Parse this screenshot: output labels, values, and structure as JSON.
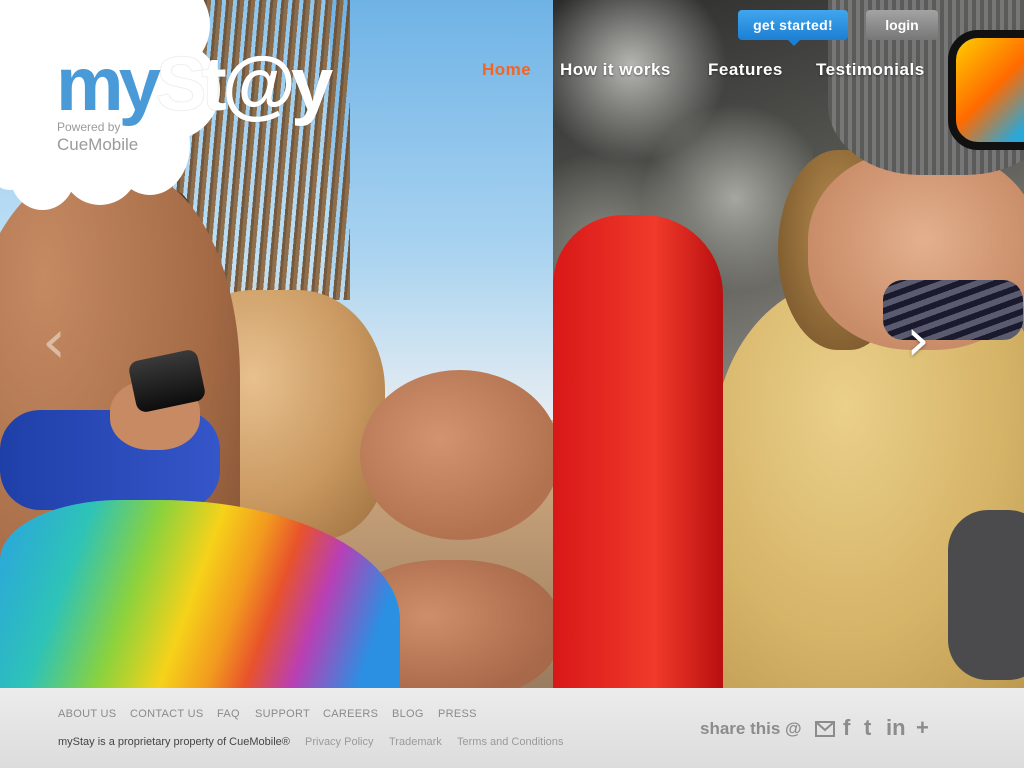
{
  "logo": {
    "my": "my",
    "stay": "St@y",
    "powered_by": "Powered by",
    "company": "CueMobile"
  },
  "nav": {
    "home": "Home",
    "how_it_works": "How it works",
    "features": "Features",
    "testimonials": "Testimonials"
  },
  "buttons": {
    "get_started": "get started!",
    "login": "login"
  },
  "carousel": {
    "prev_icon": "chevron-left-icon",
    "next_icon": "chevron-right-icon"
  },
  "footer": {
    "links": [
      "ABOUT US",
      "CONTACT US",
      "FAQ",
      "SUPPORT",
      "CAREERS",
      "BLOG",
      "PRESS"
    ],
    "copyright": "myStay is a proprietary property of CueMobile®",
    "sub_links": [
      "Privacy Policy",
      "Trademark",
      "Terms and Conditions"
    ],
    "share_label": "share this @",
    "share_icons": [
      "email-icon",
      "facebook-icon",
      "twitter-icon",
      "linkedin-icon",
      "plus-icon"
    ]
  },
  "colors": {
    "accent_orange": "#f26522",
    "button_blue": "#1c7fd3",
    "footer_bg": "#e4e4e4"
  }
}
